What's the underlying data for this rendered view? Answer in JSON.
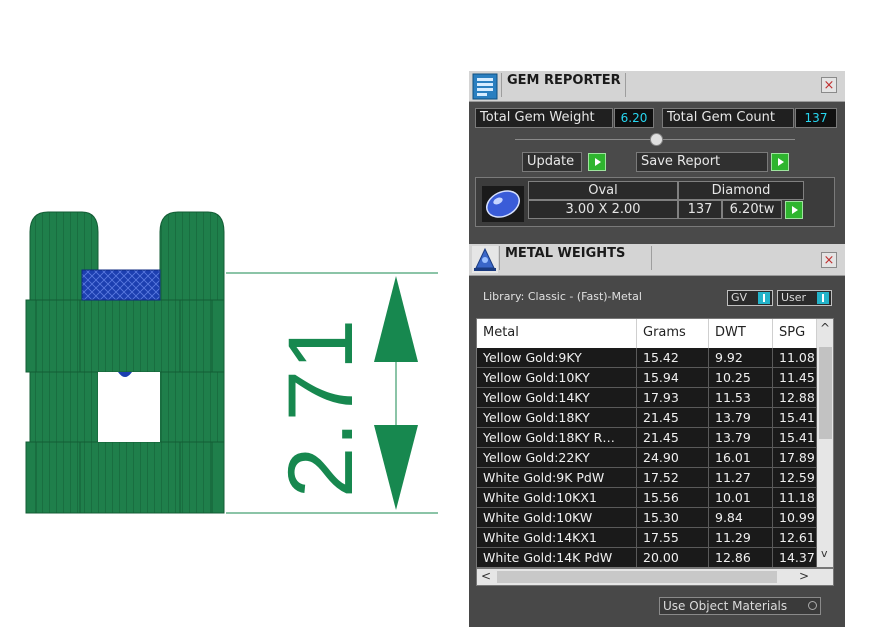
{
  "drawing": {
    "dimension_label": "2.71",
    "colors": {
      "model": "#1e7d4a",
      "model_dark": "#135c35",
      "gem": "#1c3fb0",
      "dimension": "#17884f"
    }
  },
  "gem_reporter": {
    "title": "GEM REPORTER",
    "close_glyph": "×",
    "total_weight_label": "Total Gem Weight",
    "total_weight_value": "6.20",
    "total_count_label": "Total Gem Count",
    "total_count_value": "137",
    "update_label": "Update",
    "save_report_label": "Save Report",
    "gem": {
      "shape": "Oval",
      "material": "Diamond",
      "size": "3.00 X 2.00",
      "count": "137",
      "weight": "6.20tw"
    }
  },
  "metal_weights": {
    "title": "METAL WEIGHTS",
    "close_glyph": "×",
    "library": "Library: Classic - (Fast)-Metal",
    "gv_label": "GV",
    "user_label": "User",
    "columns": [
      "Metal",
      "Grams",
      "DWT",
      "SPG"
    ],
    "rows": [
      [
        "Yellow Gold:9KY",
        "15.42",
        "9.92",
        "11.08"
      ],
      [
        "Yellow Gold:10KY",
        "15.94",
        "10.25",
        "11.45"
      ],
      [
        "Yellow Gold:14KY",
        "17.93",
        "11.53",
        "12.88"
      ],
      [
        "Yellow Gold:18KY",
        "21.45",
        "13.79",
        "15.41"
      ],
      [
        "Yellow Gold:18KY R…",
        "21.45",
        "13.79",
        "15.41"
      ],
      [
        "Yellow Gold:22KY",
        "24.90",
        "16.01",
        "17.89"
      ],
      [
        "White Gold:9K PdW",
        "17.52",
        "11.27",
        "12.59"
      ],
      [
        "White Gold:10KX1",
        "15.56",
        "10.01",
        "11.18"
      ],
      [
        "White Gold:10KW",
        "15.30",
        "9.84",
        "10.99"
      ],
      [
        "White Gold:14KX1",
        "17.55",
        "11.29",
        "12.61"
      ],
      [
        "White Gold:14K PdW",
        "20.00",
        "12.86",
        "14.37"
      ]
    ],
    "scroll_up": "^",
    "scroll_down": "v",
    "scroll_left": "<",
    "scroll_right": ">",
    "use_object_materials": "Use Object Materials"
  }
}
